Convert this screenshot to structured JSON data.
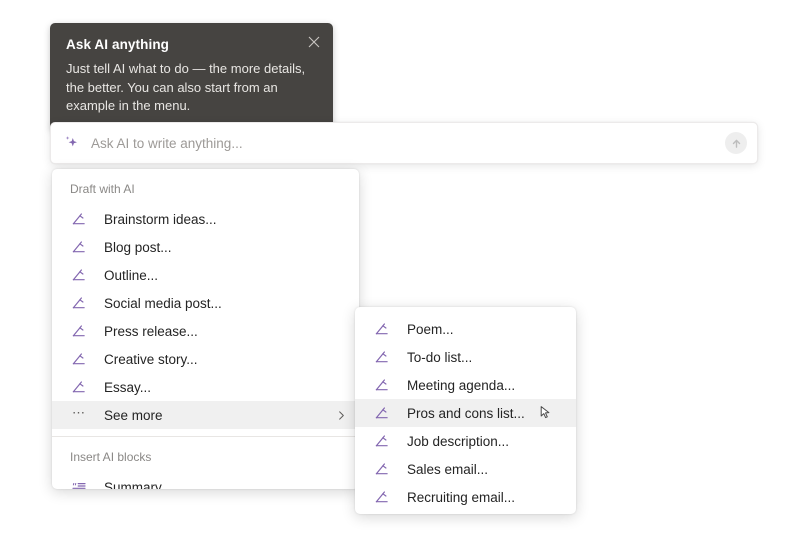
{
  "colors": {
    "accent_purple": "#8367b0",
    "tooltip_bg": "#464441",
    "menu_highlight": "#f0f0f0",
    "text_primary": "#242424",
    "text_muted": "#8a8886"
  },
  "coachmark": {
    "title": "Ask AI anything",
    "body": "Just tell AI what to do — the more details, the better. You can also start from an example in the menu.",
    "close_icon": "close-icon"
  },
  "prompt_bar": {
    "placeholder": "Ask AI to write anything...",
    "value": "",
    "leading_icon": "sparkle-icon",
    "send_icon": "arrow-up-icon"
  },
  "primary_menu": {
    "section_label": "Draft with AI",
    "items": [
      {
        "label": "Brainstorm ideas...",
        "icon": "pencil-icon",
        "selected": false
      },
      {
        "label": "Blog post...",
        "icon": "pencil-icon",
        "selected": false
      },
      {
        "label": "Outline...",
        "icon": "pencil-icon",
        "selected": false
      },
      {
        "label": "Social media post...",
        "icon": "pencil-icon",
        "selected": false
      },
      {
        "label": "Press release...",
        "icon": "pencil-icon",
        "selected": false
      },
      {
        "label": "Creative story...",
        "icon": "pencil-icon",
        "selected": false
      },
      {
        "label": "Essay...",
        "icon": "pencil-icon",
        "selected": false
      },
      {
        "label": "See more",
        "icon": "more-dots-icon",
        "selected": true,
        "has_submenu": true
      }
    ],
    "second_section_label": "Insert AI blocks",
    "second_section_items": [
      {
        "label": "Summary",
        "icon": "quote-summary-icon",
        "selected": false
      }
    ]
  },
  "submenu": {
    "items": [
      {
        "label": "Poem...",
        "icon": "pencil-icon",
        "selected": false
      },
      {
        "label": "To-do list...",
        "icon": "pencil-icon",
        "selected": false
      },
      {
        "label": "Meeting agenda...",
        "icon": "pencil-icon",
        "selected": false
      },
      {
        "label": "Pros and cons list...",
        "icon": "pencil-icon",
        "selected": true
      },
      {
        "label": "Job description...",
        "icon": "pencil-icon",
        "selected": false
      },
      {
        "label": "Sales email...",
        "icon": "pencil-icon",
        "selected": false
      },
      {
        "label": "Recruiting email...",
        "icon": "pencil-icon",
        "selected": false
      }
    ],
    "cursor_on_item_index": 3,
    "cursor_icon": "mouse-pointer-icon"
  }
}
